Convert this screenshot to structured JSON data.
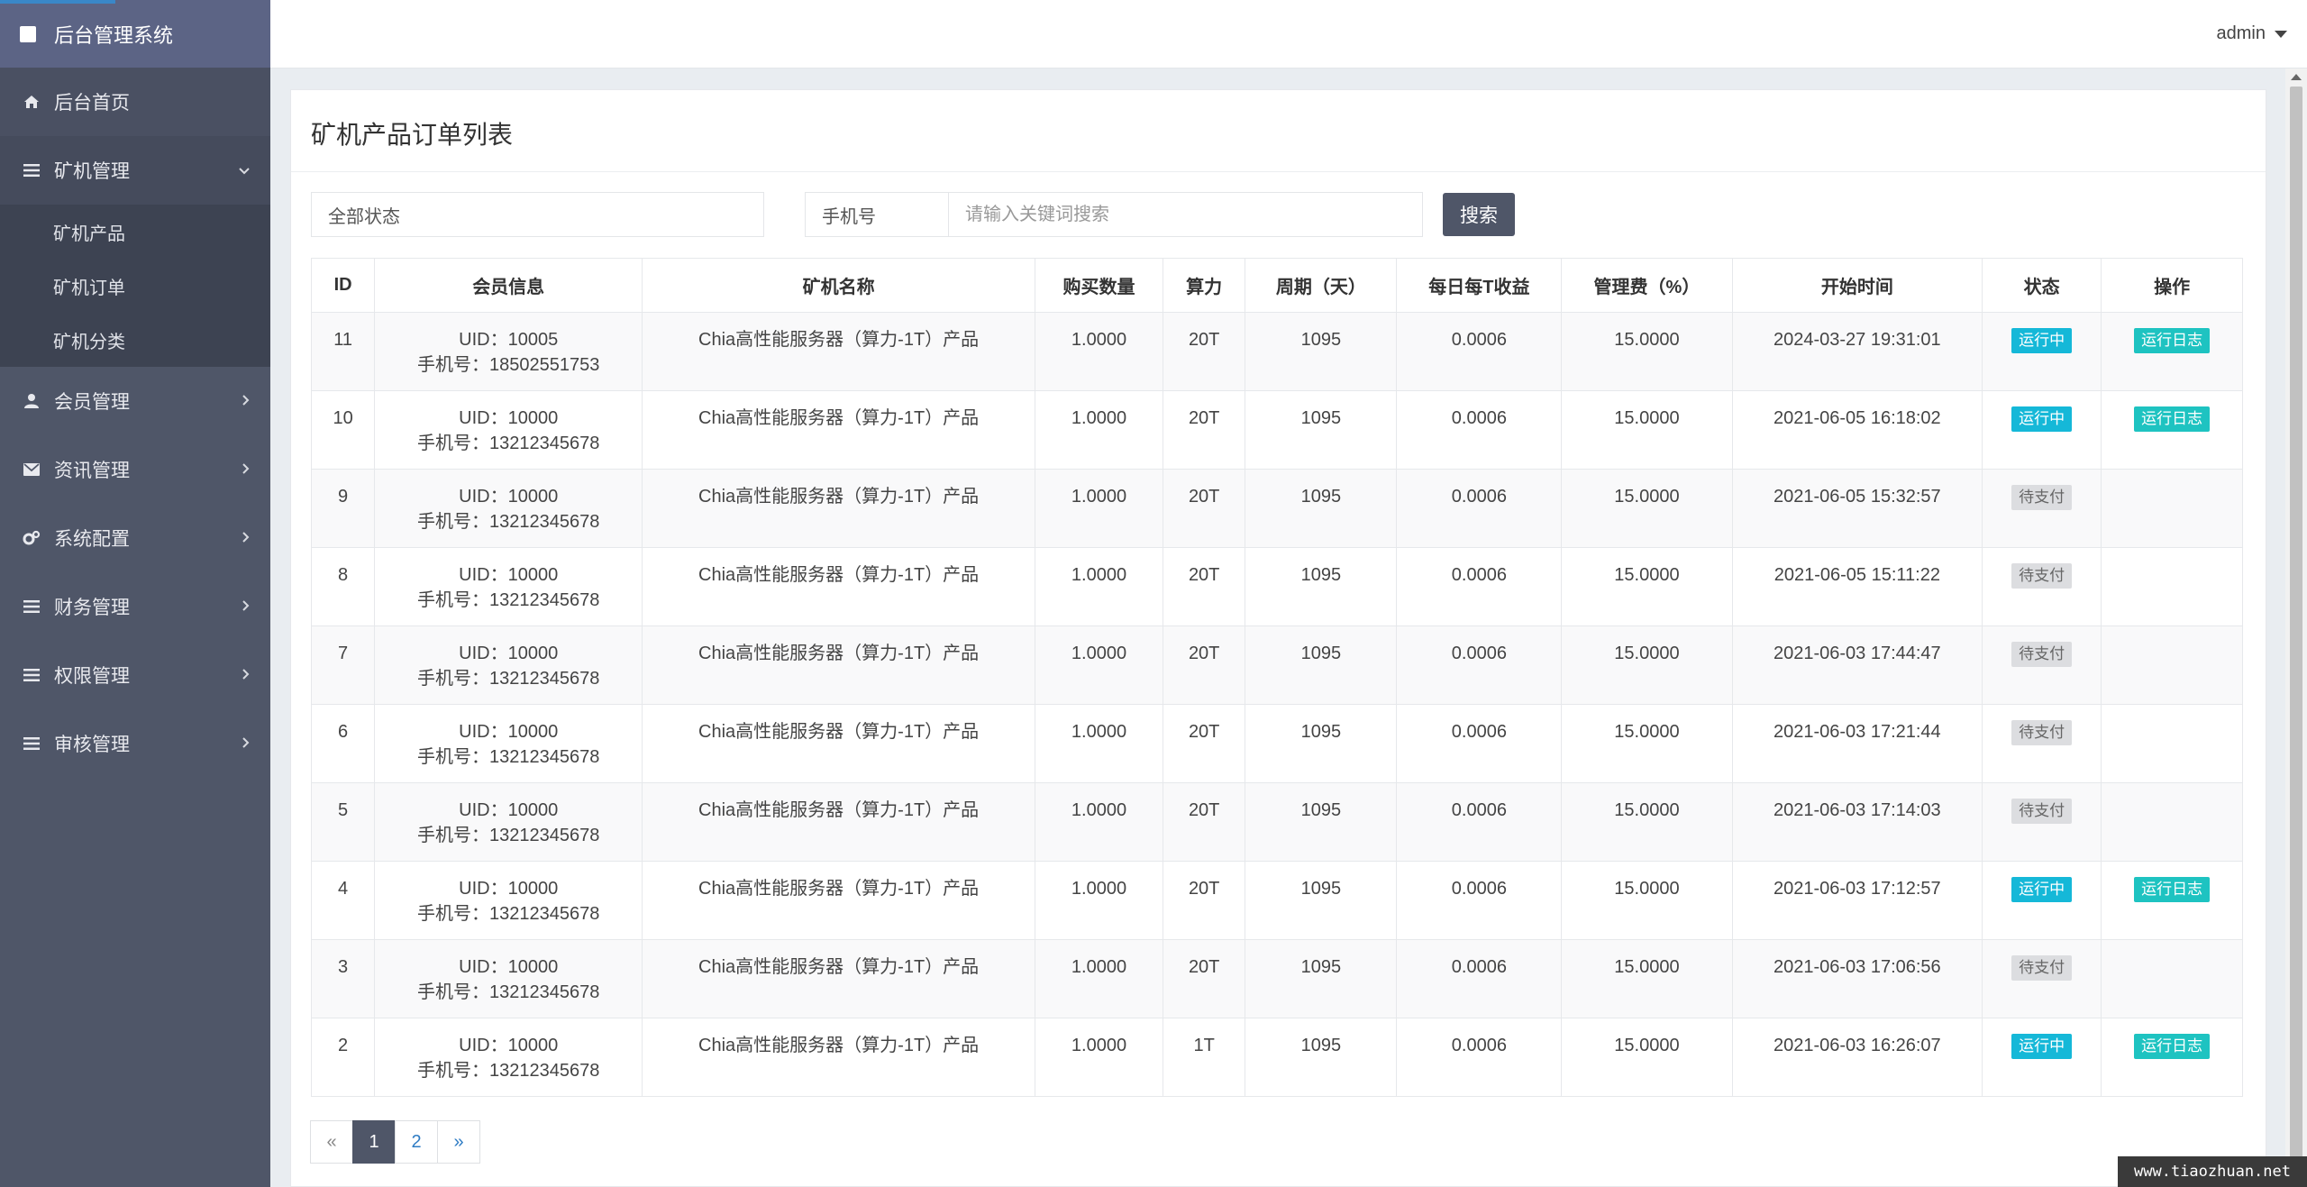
{
  "app": {
    "title": "后台管理系统"
  },
  "header": {
    "user": "admin"
  },
  "sidebar": {
    "items": [
      {
        "label": "后台首页",
        "icon": "home-icon"
      },
      {
        "label": "矿机管理",
        "icon": "list-icon",
        "expanded": true,
        "children": [
          "矿机产品",
          "矿机订单",
          "矿机分类"
        ]
      },
      {
        "label": "会员管理",
        "icon": "user-icon"
      },
      {
        "label": "资讯管理",
        "icon": "envelope-icon"
      },
      {
        "label": "系统配置",
        "icon": "gears-icon"
      },
      {
        "label": "财务管理",
        "icon": "list-icon"
      },
      {
        "label": "权限管理",
        "icon": "list-icon"
      },
      {
        "label": "审核管理",
        "icon": "list-icon"
      }
    ]
  },
  "page": {
    "title": "矿机产品订单列表"
  },
  "filters": {
    "status": "全部状态",
    "field_label": "手机号",
    "keyword_placeholder": "请输入关键词搜索",
    "search_label": "搜索"
  },
  "table": {
    "headers": [
      "ID",
      "会员信息",
      "矿机名称",
      "购买数量",
      "算力",
      "周期（天）",
      "每日每T收益",
      "管理费（%）",
      "开始时间",
      "状态",
      "操作"
    ],
    "rows": [
      {
        "id": "11",
        "uid": "UID：10005",
        "phone": "手机号：18502551753",
        "name": "Chia高性能服务器（算力-1T）产品",
        "qty": "1.0000",
        "power": "20T",
        "period": "1095",
        "daily": "0.0006",
        "fee": "15.0000",
        "start": "2024-03-27 19:31:01",
        "status": "运行中",
        "status_type": "run",
        "action": "运行日志"
      },
      {
        "id": "10",
        "uid": "UID：10000",
        "phone": "手机号：13212345678",
        "name": "Chia高性能服务器（算力-1T）产品",
        "qty": "1.0000",
        "power": "20T",
        "period": "1095",
        "daily": "0.0006",
        "fee": "15.0000",
        "start": "2021-06-05 16:18:02",
        "status": "运行中",
        "status_type": "run",
        "action": "运行日志"
      },
      {
        "id": "9",
        "uid": "UID：10000",
        "phone": "手机号：13212345678",
        "name": "Chia高性能服务器（算力-1T）产品",
        "qty": "1.0000",
        "power": "20T",
        "period": "1095",
        "daily": "0.0006",
        "fee": "15.0000",
        "start": "2021-06-05 15:32:57",
        "status": "待支付",
        "status_type": "wait",
        "action": ""
      },
      {
        "id": "8",
        "uid": "UID：10000",
        "phone": "手机号：13212345678",
        "name": "Chia高性能服务器（算力-1T）产品",
        "qty": "1.0000",
        "power": "20T",
        "period": "1095",
        "daily": "0.0006",
        "fee": "15.0000",
        "start": "2021-06-05 15:11:22",
        "status": "待支付",
        "status_type": "wait",
        "action": ""
      },
      {
        "id": "7",
        "uid": "UID：10000",
        "phone": "手机号：13212345678",
        "name": "Chia高性能服务器（算力-1T）产品",
        "qty": "1.0000",
        "power": "20T",
        "period": "1095",
        "daily": "0.0006",
        "fee": "15.0000",
        "start": "2021-06-03 17:44:47",
        "status": "待支付",
        "status_type": "wait",
        "action": ""
      },
      {
        "id": "6",
        "uid": "UID：10000",
        "phone": "手机号：13212345678",
        "name": "Chia高性能服务器（算力-1T）产品",
        "qty": "1.0000",
        "power": "20T",
        "period": "1095",
        "daily": "0.0006",
        "fee": "15.0000",
        "start": "2021-06-03 17:21:44",
        "status": "待支付",
        "status_type": "wait",
        "action": ""
      },
      {
        "id": "5",
        "uid": "UID：10000",
        "phone": "手机号：13212345678",
        "name": "Chia高性能服务器（算力-1T）产品",
        "qty": "1.0000",
        "power": "20T",
        "period": "1095",
        "daily": "0.0006",
        "fee": "15.0000",
        "start": "2021-06-03 17:14:03",
        "status": "待支付",
        "status_type": "wait",
        "action": ""
      },
      {
        "id": "4",
        "uid": "UID：10000",
        "phone": "手机号：13212345678",
        "name": "Chia高性能服务器（算力-1T）产品",
        "qty": "1.0000",
        "power": "20T",
        "period": "1095",
        "daily": "0.0006",
        "fee": "15.0000",
        "start": "2021-06-03 17:12:57",
        "status": "运行中",
        "status_type": "run",
        "action": "运行日志"
      },
      {
        "id": "3",
        "uid": "UID：10000",
        "phone": "手机号：13212345678",
        "name": "Chia高性能服务器（算力-1T）产品",
        "qty": "1.0000",
        "power": "20T",
        "period": "1095",
        "daily": "0.0006",
        "fee": "15.0000",
        "start": "2021-06-03 17:06:56",
        "status": "待支付",
        "status_type": "wait",
        "action": ""
      },
      {
        "id": "2",
        "uid": "UID：10000",
        "phone": "手机号：13212345678",
        "name": "Chia高性能服务器（算力-1T）产品",
        "qty": "1.0000",
        "power": "1T",
        "period": "1095",
        "daily": "0.0006",
        "fee": "15.0000",
        "start": "2021-06-03 16:26:07",
        "status": "运行中",
        "status_type": "run",
        "action": "运行日志"
      }
    ]
  },
  "pagination": {
    "prev": "«",
    "pages": [
      "1",
      "2"
    ],
    "active": "1",
    "next": "»"
  },
  "watermark": "www.tiaozhuan.net",
  "colors": {
    "sidebar": "#4f5668",
    "brand": "#5c6485",
    "running": "#15b8d8",
    "log": "#1ec3c1",
    "pending": "#dcdde0"
  }
}
